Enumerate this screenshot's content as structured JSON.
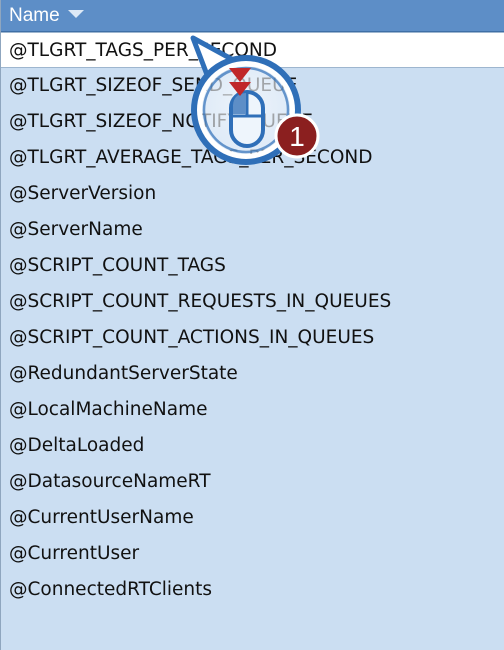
{
  "header": {
    "name_label": "Name",
    "sort_icon": "chevron-down-icon"
  },
  "rows": [
    "@TLGRT_TAGS_PER_SECOND",
    "@TLGRT_SIZEOF_SEND_QUEUE",
    "@TLGRT_SIZEOF_NOTIFY_QUEUE",
    "@TLGRT_AVERAGE_TAGS_PER_SECOND",
    "@ServerVersion",
    "@ServerName",
    "@SCRIPT_COUNT_TAGS",
    "@SCRIPT_COUNT_REQUESTS_IN_QUEUES",
    "@SCRIPT_COUNT_ACTIONS_IN_QUEUES",
    "@RedundantServerState",
    "@LocalMachineName",
    "@DeltaLoaded",
    "@DatasourceNameRT",
    "@CurrentUserName",
    "@CurrentUser",
    "@ConnectedRTClients"
  ],
  "selected_row_index": 0,
  "callout": {
    "step_number": "1",
    "icon": "mouse-left-click-icon",
    "colors": {
      "ring": "#2f6fb8",
      "badge": "#8b1f1f",
      "arrow": "#c0282a"
    }
  }
}
